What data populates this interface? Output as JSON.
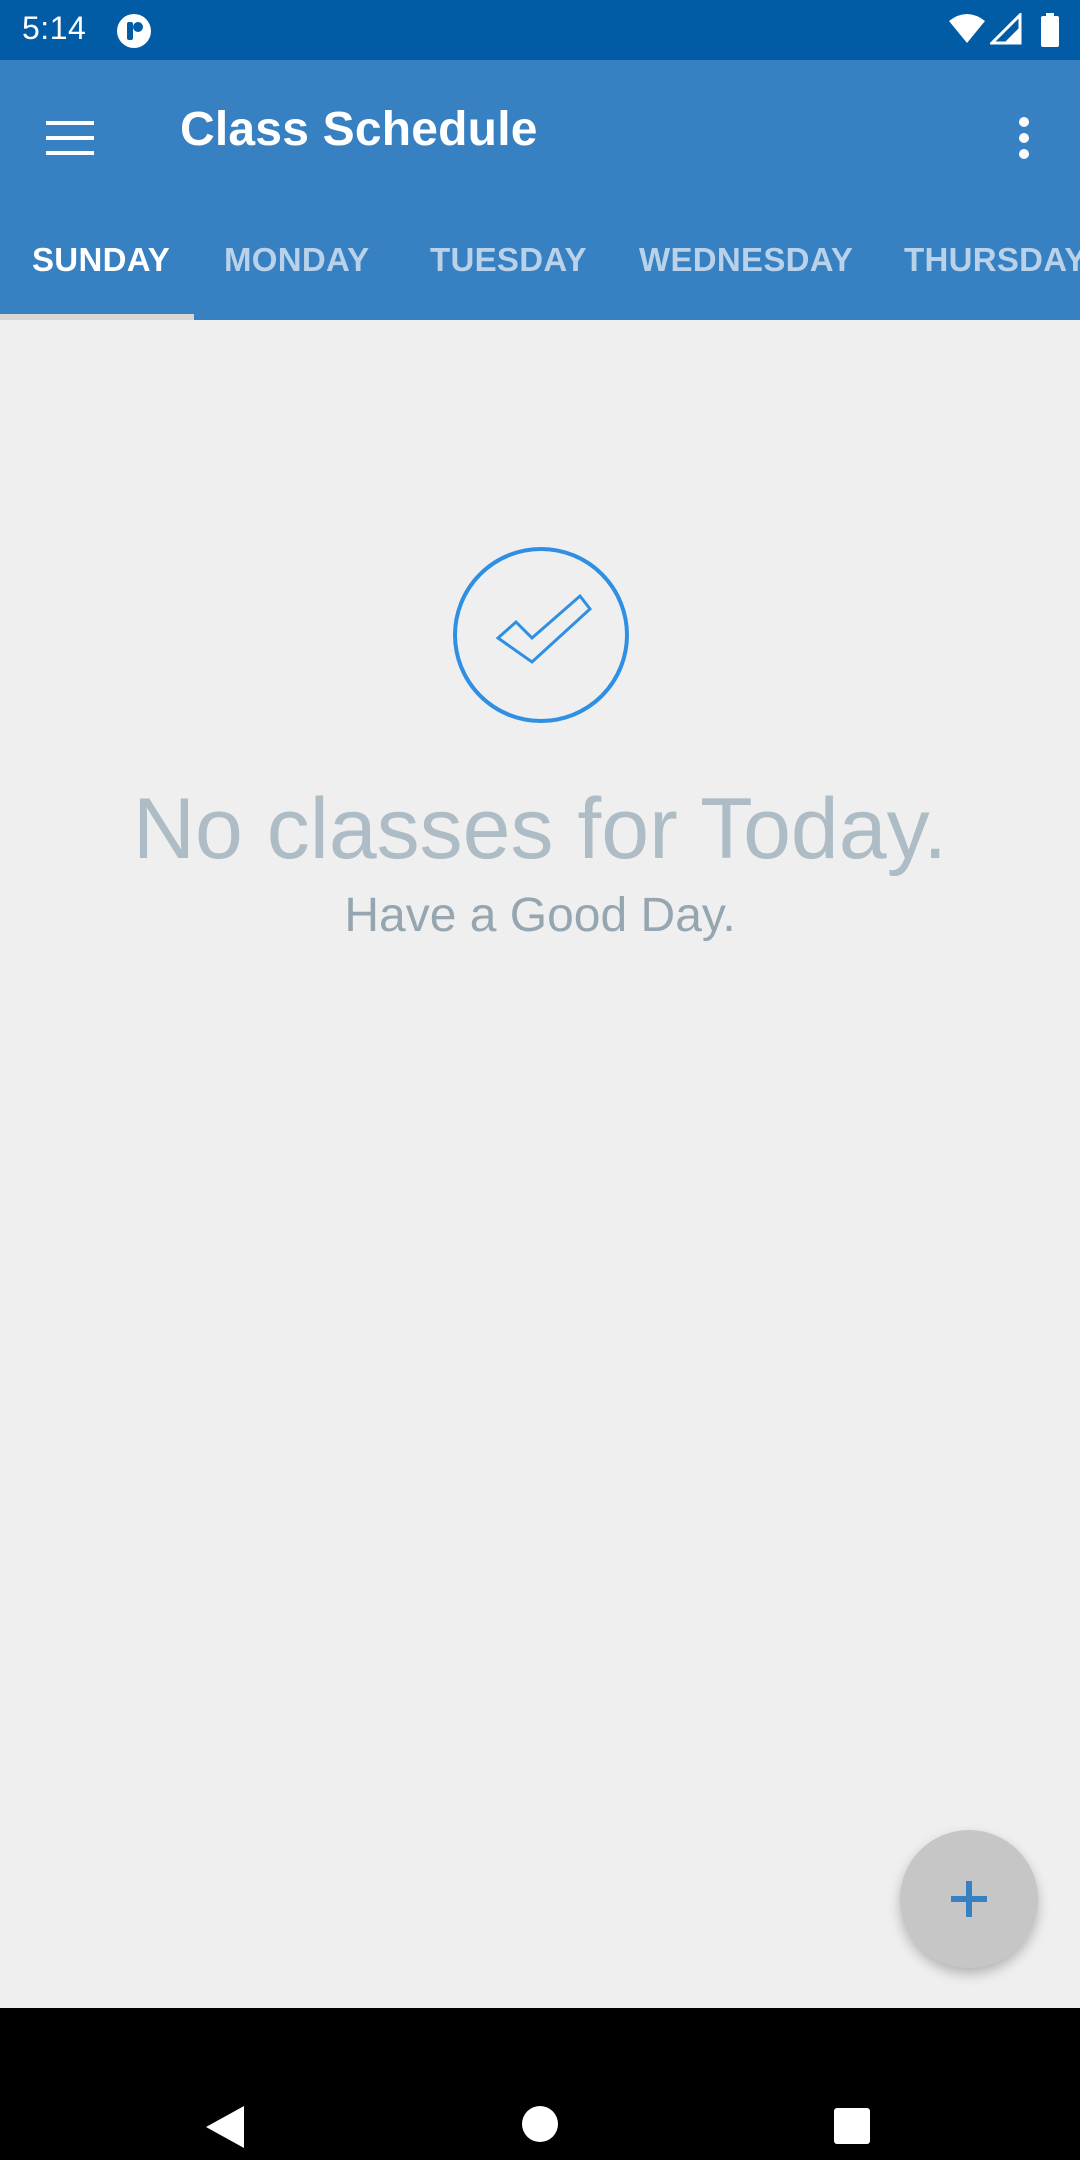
{
  "status_bar": {
    "time": "5:14",
    "icons": [
      "app-notification-icon",
      "wifi-icon",
      "signal-icon",
      "battery-icon"
    ]
  },
  "app_bar": {
    "title": "Class Schedule",
    "menu_icon": "hamburger-menu-icon",
    "overflow_icon": "more-vert-icon"
  },
  "tabs": [
    {
      "label": "SUNDAY",
      "active": true
    },
    {
      "label": "MONDAY",
      "active": false
    },
    {
      "label": "TUESDAY",
      "active": false
    },
    {
      "label": "WEDNESDAY",
      "active": false
    },
    {
      "label": "THURSDAY",
      "active": false
    }
  ],
  "empty_state": {
    "icon": "check-circle-icon",
    "title": "No classes for Today.",
    "subtitle": "Have a Good Day."
  },
  "fab": {
    "icon": "plus-icon"
  },
  "nav_bar": {
    "icons": [
      "back-icon",
      "home-icon",
      "recents-icon"
    ]
  },
  "colors": {
    "status_bar": "#015ba5",
    "app_bar": "#3780c1",
    "accent": "#2f8fe2",
    "background": "#efefef"
  }
}
